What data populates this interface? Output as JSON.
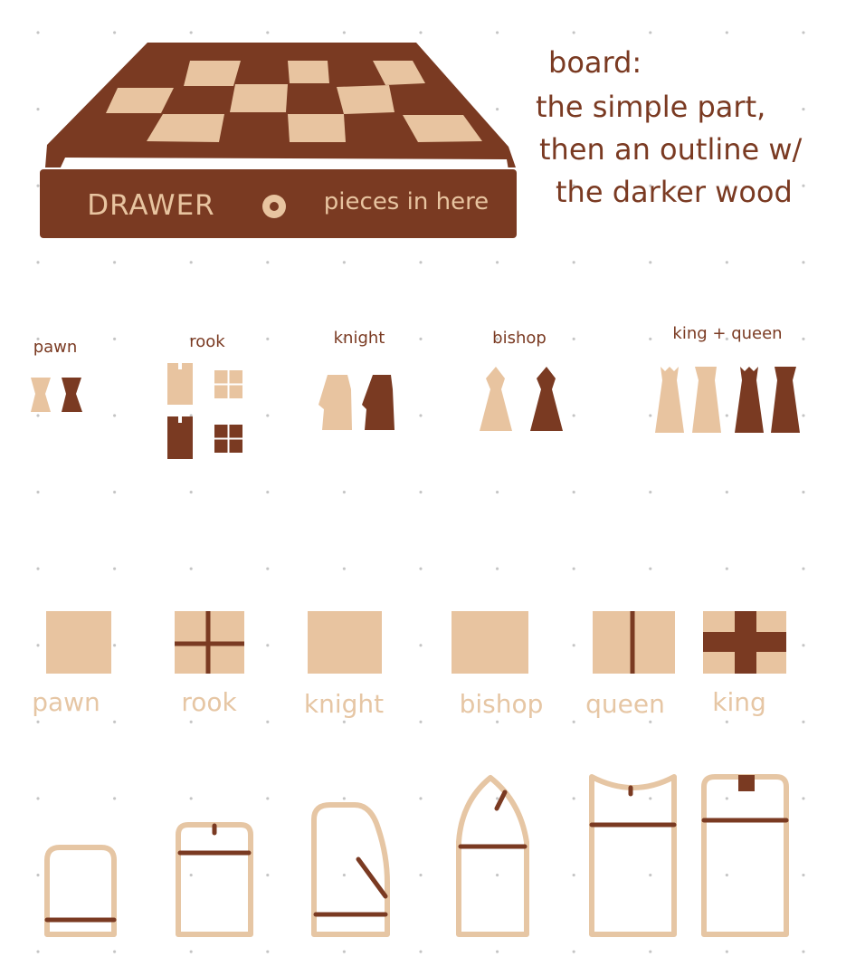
{
  "colors": {
    "dark_wood": "#7a3a22",
    "light_wood": "#e8c4a0",
    "outline_wood": "#e6c6a4",
    "white": "#ffffff"
  },
  "board": {
    "drawer_label": "DRAWER",
    "drawer_note": "pieces in here",
    "note_lines": [
      "board:",
      "the simple part,",
      "then an outline w/",
      "the darker wood"
    ]
  },
  "pieces_row": {
    "pawn": "pawn",
    "rook": "rook",
    "knight": "knight",
    "bishop": "bishop",
    "king_queen": "king + queen"
  },
  "tiles_row": {
    "pawn": "pawn",
    "rook": "rook",
    "knight": "knight",
    "bishop": "bishop",
    "queen": "queen",
    "king": "king"
  }
}
